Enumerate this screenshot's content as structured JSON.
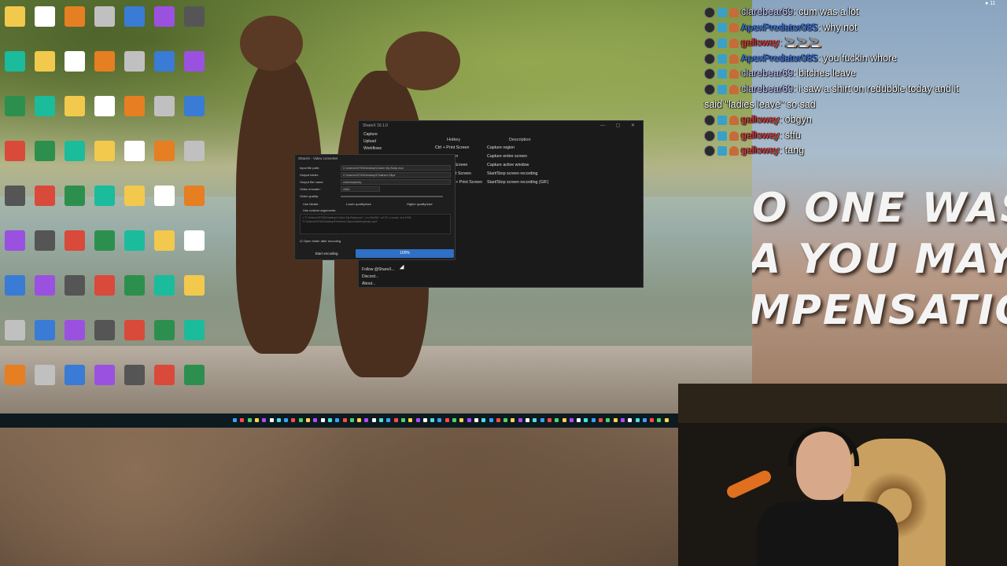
{
  "app_window": {
    "title": "ShareX 16.1.0",
    "menu": [
      "Capture",
      "Upload",
      "Workflows"
    ],
    "hotkey_header": "Hotkey",
    "description_header": "Description",
    "hotkeys": [
      {
        "key": "Ctrl + Print Screen",
        "desc": "Capture region"
      },
      {
        "key": "Print Screen",
        "desc": "Capture entire screen"
      },
      {
        "key": "Alt + Print Screen",
        "desc": "Capture active window"
      },
      {
        "key": "Shift + Print Screen",
        "desc": "Start/Stop screen recording"
      },
      {
        "key": "Ctrl + Shift + Print Screen",
        "desc": "Start/Stop screen recording (GIF)"
      }
    ],
    "side_links": [
      "Follow @ShareX...",
      "Discord...",
      "About..."
    ]
  },
  "converter": {
    "title": "ShareX - Video converter",
    "labels": [
      "Input file path:",
      "Output folder:",
      "Output file name:",
      "Video encoder:",
      "Video quality:",
      "Use bitrate:",
      "Use custom arguments:"
    ],
    "input_path": "C:\\Users\\19794\\Desktop\\Clutch My Body.mov",
    "output_folder": "C:\\Users\\19794\\Desktop\\Finished Clips",
    "output_name": "clutchmybody",
    "encoder": "x264",
    "quality_low": "Lower quality/size",
    "quality_high": "Higher quality/size",
    "args_text": "-i \"C:\\Users\\19794\\Desktop\\Clutch My Body.mov\" -c:v libx264 -crf 23 -c:a aac -b:a 192k \"C:\\Users\\19794\\Desktop\\Finished Clips\\clutchmybody.mp4\"",
    "open_folder_label": "Open folder after encoding",
    "start_button": "Start encoding",
    "progress": "100%"
  },
  "chat": [
    {
      "user": "clarebear69",
      "msg": "cum was a lot",
      "color": "#c8c8ff"
    },
    {
      "user": "ApexPredator085",
      "msg": "why not",
      "color": "#3a7cff"
    },
    {
      "user": "galloway",
      "msg": "🚬🚬🚬",
      "color": "#ff3a3a"
    },
    {
      "user": "ApexPredator085",
      "msg": "you fuckin whore",
      "color": "#3a7cff"
    },
    {
      "user": "clarebear69",
      "msg": "bitches leave",
      "color": "#c8c8ff"
    },
    {
      "user": "clarebear69",
      "msg": "i saw a shirt on redubble today and it",
      "color": "#c8c8ff"
    },
    {
      "user": "",
      "msg": "said \"ladies leave\" so sad",
      "color": "#ffffff"
    },
    {
      "user": "galloway",
      "msg": "obgyn",
      "color": "#ff3a3a"
    },
    {
      "user": "galloway",
      "msg": "stfu",
      "color": "#ff3a3a"
    },
    {
      "user": "galloway",
      "msg": "tang",
      "color": "#ff3a3a"
    }
  ],
  "sign": [
    "O ONE WAS",
    "A YOU MAY",
    "MPENSATION"
  ],
  "tray": "11"
}
